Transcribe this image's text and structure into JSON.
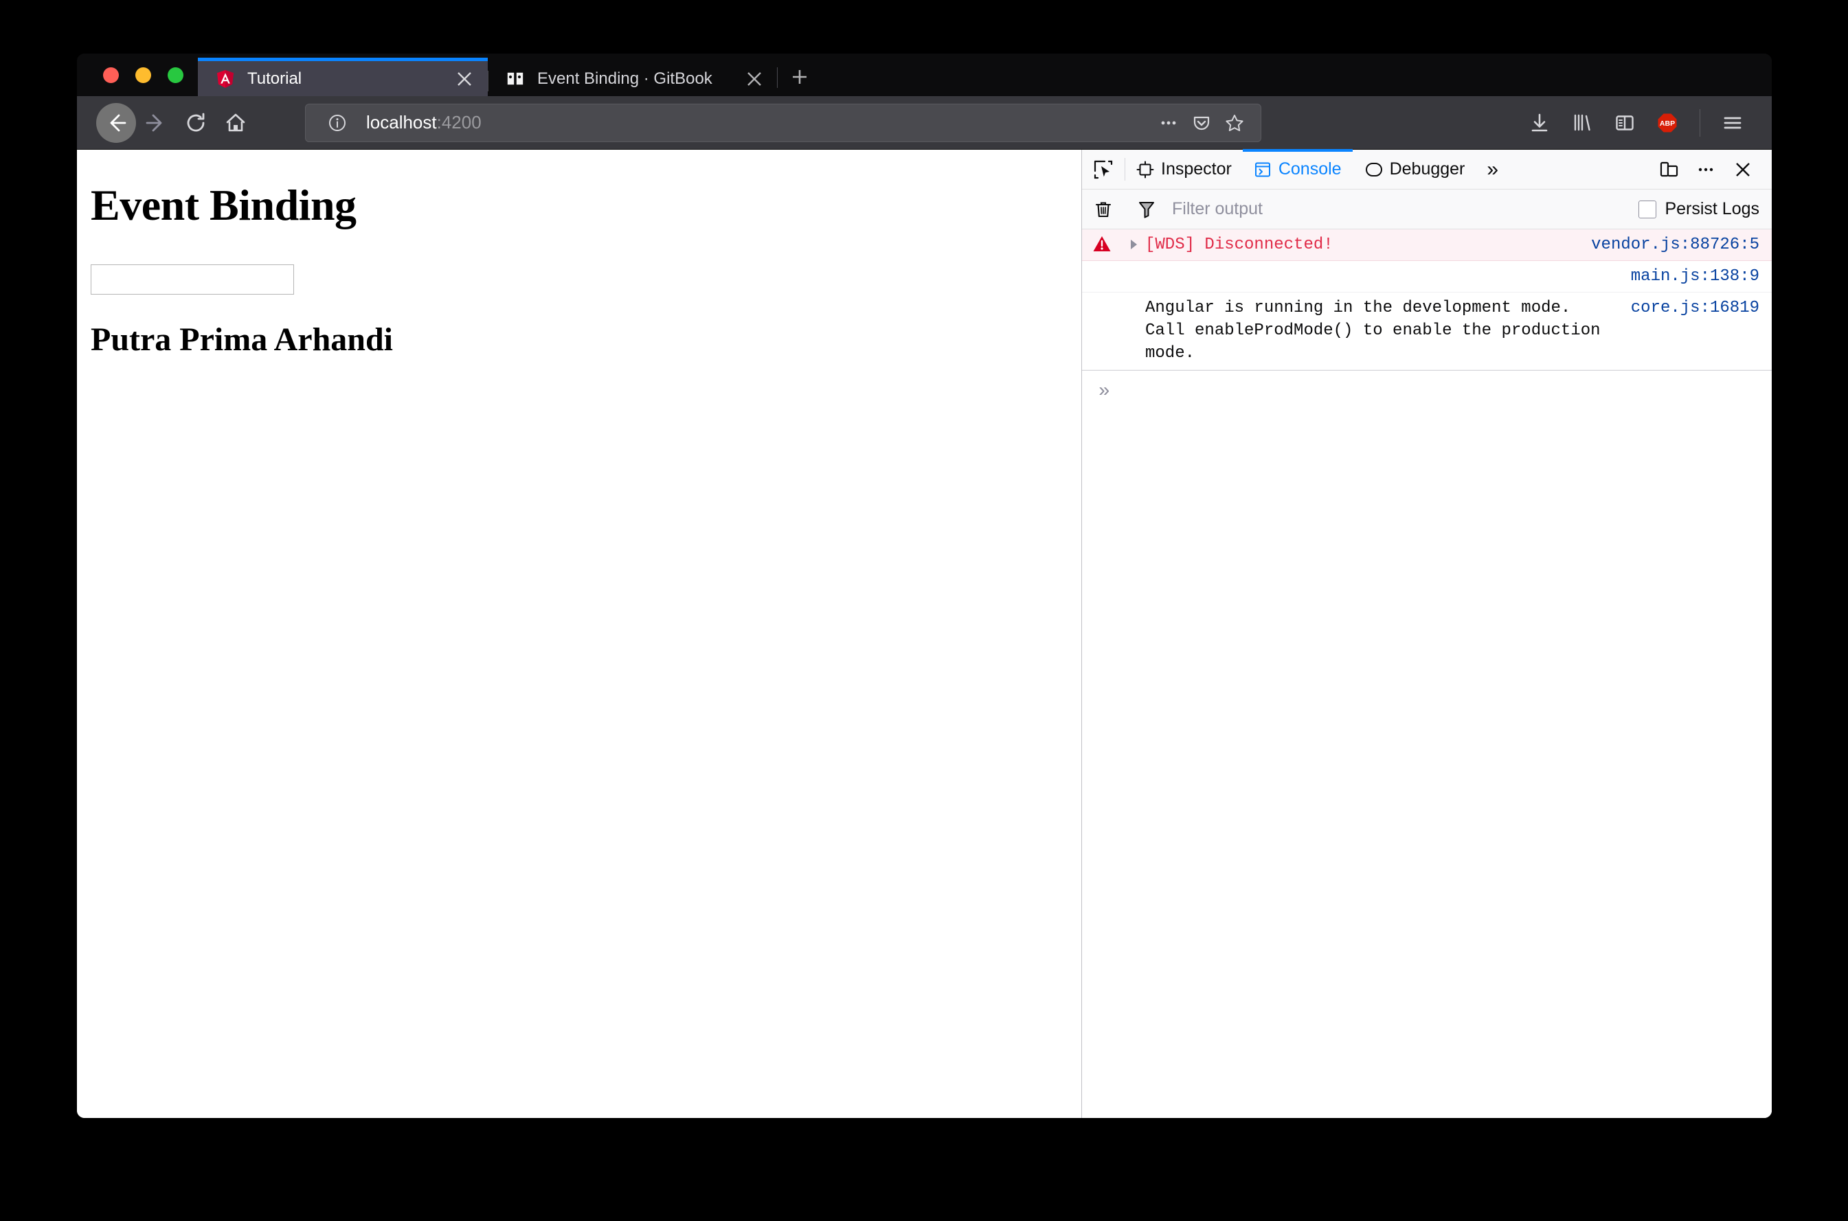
{
  "window": {
    "traffic_lights": [
      "close",
      "minimize",
      "maximize"
    ]
  },
  "tabs": [
    {
      "title": "Tutorial",
      "favicon": "angular-icon",
      "active": true,
      "close_label": "×"
    },
    {
      "title": "Event Binding · GitBook",
      "favicon": "gitbook-icon",
      "active": false,
      "close_label": "×"
    }
  ],
  "new_tab_label": "+",
  "navigation": {
    "back": "back-arrow-icon",
    "forward": "forward-arrow-icon",
    "reload": "reload-icon",
    "home": "home-icon",
    "url_prefix": "localhost",
    "url_suffix": ":4200",
    "url_full": "localhost:4200",
    "page_actions_label": "•••",
    "pocket": "pocket-icon",
    "bookmark": "star-icon",
    "downloads": "download-icon",
    "library": "library-icon",
    "sidebar": "sidebar-icon",
    "adblock_label": "ABP",
    "menu": "hamburger-menu-icon"
  },
  "page": {
    "heading": "Event Binding",
    "input_value": "",
    "input_placeholder": "",
    "subheading": "Putra Prima Arhandi"
  },
  "devtools": {
    "picker_icon": "element-picker-icon",
    "tabs": [
      {
        "label": "Inspector",
        "icon": "inspector-icon",
        "active": false
      },
      {
        "label": "Console",
        "icon": "console-icon",
        "active": true
      },
      {
        "label": "Debugger",
        "icon": "debugger-icon",
        "active": false
      }
    ],
    "more_tabs_label": "»",
    "responsive_mode_icon": "responsive-design-mode-icon",
    "meatball_label": "•••",
    "close_label": "✕",
    "console": {
      "clear_icon": "trash-icon",
      "filter_icon": "funnel-icon",
      "filter_placeholder": "Filter output",
      "filter_value": "",
      "persist_logs_label": "Persist Logs",
      "persist_logs_checked": false,
      "prompt_label": "»",
      "messages": [
        {
          "severity": "error",
          "icon": "error-triangle-icon",
          "expandable": true,
          "text": "[WDS] Disconnected!",
          "source": "vendor.js:88726:5"
        },
        {
          "severity": "log",
          "icon": "",
          "expandable": false,
          "text": "",
          "source": "main.js:138:9"
        },
        {
          "severity": "log",
          "icon": "",
          "expandable": false,
          "text": "Angular is running in the development mode. Call enableProdMode() to enable the production mode.",
          "source": "core.js:16819"
        }
      ]
    }
  },
  "colors": {
    "accent_blue": "#0a84ff",
    "error_red": "#e02b48",
    "source_link": "#0842a0",
    "tabbar_bg": "#0c0c0d",
    "toolbar_bg": "#38383d",
    "active_tab_bg": "#42414d",
    "adblock_red": "#d81e06",
    "angular_red": "#dd0031"
  }
}
